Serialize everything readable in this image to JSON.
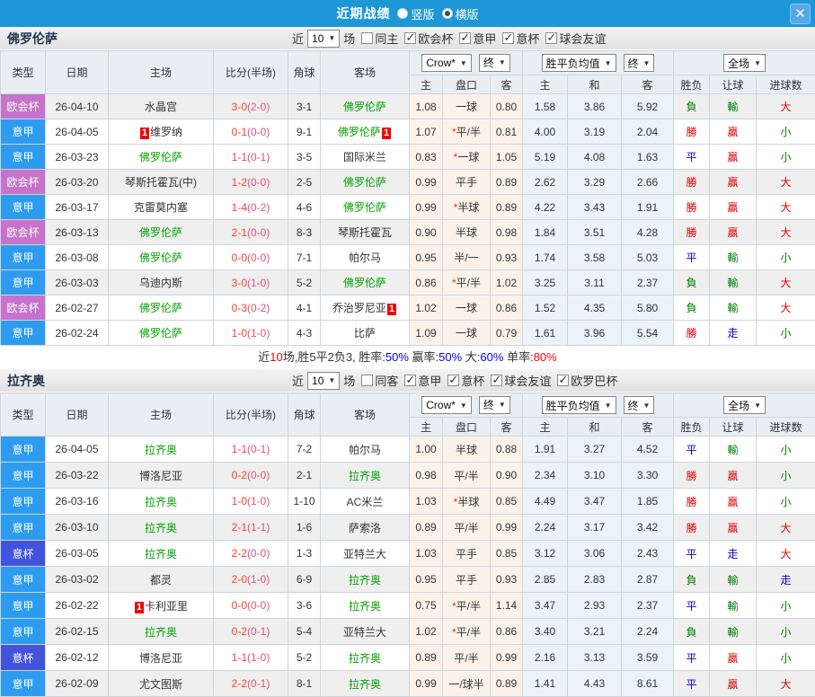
{
  "topbar": {
    "title": "近期战绩",
    "radios": [
      {
        "label": "竖版",
        "selected": false
      },
      {
        "label": "横版",
        "selected": true
      }
    ],
    "close_glyph": "✕"
  },
  "table_header": {
    "cols": [
      "类型",
      "日期",
      "主场",
      "比分(半场)",
      "角球",
      "客场"
    ],
    "dropdowns": {
      "odds": "Crow*",
      "final1": "终",
      "avg": "胜平负均值",
      "final2": "终",
      "full": "全场"
    },
    "arrow": "▼",
    "sub": [
      "主",
      "盘口",
      "客",
      "主",
      "和",
      "客",
      "胜负",
      "让球",
      "进球数"
    ]
  },
  "league_colors": {
    "欧会杯": "#c573cb",
    "意甲": "#2d9cf0",
    "意杯": "#4254de"
  },
  "result_colors": {
    "勝": "#e00000",
    "贏": "#e00000",
    "大": "#e00000",
    "平": "#0000dd",
    "走": "#0000dd",
    "負": "#008000",
    "輸": "#008000",
    "小": "#008000"
  },
  "sections": [
    {
      "team": "佛罗伦萨",
      "filters": {
        "near_label": "近",
        "count": "10",
        "games_label": "场",
        "checkboxes": [
          {
            "label": "同主",
            "checked": false
          },
          {
            "label": "欧会杯",
            "checked": true
          },
          {
            "label": "意甲",
            "checked": true
          },
          {
            "label": "意杯",
            "checked": true
          },
          {
            "label": "球会友谊",
            "checked": true
          }
        ]
      },
      "rows": [
        {
          "league": "欧会杯",
          "date": "26-04-10",
          "home": {
            "name": "水晶宫"
          },
          "score": "3-0(2-0)",
          "corner": "3-1",
          "away": {
            "name": "佛罗伦萨",
            "focus": true
          },
          "odds": [
            "1.08",
            "一球",
            "0.80"
          ],
          "avg": [
            "1.58",
            "3.86",
            "5.92"
          ],
          "res": [
            "負",
            "輸",
            "大"
          ],
          "shaded": true
        },
        {
          "league": "意甲",
          "date": "26-04-05",
          "home": {
            "name": "维罗纳",
            "red": "1",
            "red_pos": "before"
          },
          "score": "0-1(0-0)",
          "corner": "9-1",
          "away": {
            "name": "佛罗伦萨",
            "focus": true,
            "red": "1",
            "red_pos": "after"
          },
          "odds": [
            "1.07",
            "*平/半",
            "0.81"
          ],
          "avg": [
            "4.00",
            "3.19",
            "2.04"
          ],
          "res": [
            "勝",
            "贏",
            "小"
          ],
          "shaded": false
        },
        {
          "league": "意甲",
          "date": "26-03-23",
          "home": {
            "name": "佛罗伦萨",
            "focus": true
          },
          "score": "1-1(0-1)",
          "corner": "3-5",
          "away": {
            "name": "国际米兰"
          },
          "odds": [
            "0.83",
            "*一球",
            "1.05"
          ],
          "avg": [
            "5.19",
            "4.08",
            "1.63"
          ],
          "res": [
            "平",
            "贏",
            "小"
          ],
          "shaded": false
        },
        {
          "league": "欧会杯",
          "date": "26-03-20",
          "home": {
            "name": "琴斯托霍瓦(中)"
          },
          "score": "1-2(0-0)",
          "corner": "2-5",
          "away": {
            "name": "佛罗伦萨",
            "focus": true
          },
          "odds": [
            "0.99",
            "平手",
            "0.89"
          ],
          "avg": [
            "2.62",
            "3.29",
            "2.66"
          ],
          "res": [
            "勝",
            "贏",
            "大"
          ],
          "shaded": true
        },
        {
          "league": "意甲",
          "date": "26-03-17",
          "home": {
            "name": "克雷莫内塞"
          },
          "score": "1-4(0-2)",
          "corner": "4-6",
          "away": {
            "name": "佛罗伦萨",
            "focus": true
          },
          "odds": [
            "0.99",
            "*半球",
            "0.89"
          ],
          "avg": [
            "4.22",
            "3.43",
            "1.91"
          ],
          "res": [
            "勝",
            "贏",
            "大"
          ],
          "shaded": false
        },
        {
          "league": "欧会杯",
          "date": "26-03-13",
          "home": {
            "name": "佛罗伦萨",
            "focus": true
          },
          "score": "2-1(0-0)",
          "corner": "8-3",
          "away": {
            "name": "琴斯托霍瓦"
          },
          "odds": [
            "0.90",
            "半球",
            "0.98"
          ],
          "avg": [
            "1.84",
            "3.51",
            "4.28"
          ],
          "res": [
            "勝",
            "贏",
            "大"
          ],
          "shaded": true
        },
        {
          "league": "意甲",
          "date": "26-03-08",
          "home": {
            "name": "佛罗伦萨",
            "focus": true
          },
          "score": "0-0(0-0)",
          "corner": "7-1",
          "away": {
            "name": "帕尔马"
          },
          "odds": [
            "0.95",
            "半/一",
            "0.93"
          ],
          "avg": [
            "1.74",
            "3.58",
            "5.03"
          ],
          "res": [
            "平",
            "輸",
            "小"
          ],
          "shaded": false
        },
        {
          "league": "意甲",
          "date": "26-03-03",
          "home": {
            "name": "乌迪内斯"
          },
          "score": "3-0(1-0)",
          "corner": "5-2",
          "away": {
            "name": "佛罗伦萨",
            "focus": true
          },
          "odds": [
            "0.86",
            "*平/半",
            "1.02"
          ],
          "avg": [
            "3.25",
            "3.11",
            "2.37"
          ],
          "res": [
            "負",
            "輸",
            "大"
          ],
          "shaded": true
        },
        {
          "league": "欧会杯",
          "date": "26-02-27",
          "home": {
            "name": "佛罗伦萨",
            "focus": true
          },
          "score": "0-3(0-2)",
          "corner": "4-1",
          "away": {
            "name": "乔治罗尼亚",
            "red": "1",
            "red_pos": "after"
          },
          "odds": [
            "1.02",
            "一球",
            "0.86"
          ],
          "avg": [
            "1.52",
            "4.35",
            "5.80"
          ],
          "res": [
            "負",
            "輸",
            "大"
          ],
          "shaded": false
        },
        {
          "league": "意甲",
          "date": "26-02-24",
          "home": {
            "name": "佛罗伦萨",
            "focus": true
          },
          "score": "1-0(1-0)",
          "corner": "4-3",
          "away": {
            "name": "比萨"
          },
          "odds": [
            "1.09",
            "一球",
            "0.79"
          ],
          "avg": [
            "1.61",
            "3.96",
            "5.54"
          ],
          "res": [
            "勝",
            "走",
            "小"
          ],
          "shaded": false
        }
      ],
      "summary": [
        {
          "t": "近",
          "c": "#333333"
        },
        {
          "t": "10",
          "c": "#ff0000"
        },
        {
          "t": "场,胜5平2负3, 胜率:",
          "c": "#333333"
        },
        {
          "t": "50%",
          "c": "#0000ff"
        },
        {
          "t": " 赢率:",
          "c": "#333333"
        },
        {
          "t": "50%",
          "c": "#0000ff"
        },
        {
          "t": " 大:",
          "c": "#333333"
        },
        {
          "t": "60%",
          "c": "#0000ff"
        },
        {
          "t": " 单率:",
          "c": "#333333"
        },
        {
          "t": "80%",
          "c": "#ff0000"
        }
      ]
    },
    {
      "team": "拉齐奥",
      "filters": {
        "near_label": "近",
        "count": "10",
        "games_label": "场",
        "checkboxes": [
          {
            "label": "同客",
            "checked": false
          },
          {
            "label": "意甲",
            "checked": true
          },
          {
            "label": "意杯",
            "checked": true
          },
          {
            "label": "球会友谊",
            "checked": true
          },
          {
            "label": "欧罗巴杯",
            "checked": true
          }
        ]
      },
      "rows": [
        {
          "league": "意甲",
          "date": "26-04-05",
          "home": {
            "name": "拉齐奥",
            "focus": true
          },
          "score": "1-1(0-1)",
          "corner": "7-2",
          "away": {
            "name": "帕尔马"
          },
          "odds": [
            "1.00",
            "半球",
            "0.88"
          ],
          "avg": [
            "1.91",
            "3.27",
            "4.52"
          ],
          "res": [
            "平",
            "輸",
            "小"
          ],
          "shaded": false
        },
        {
          "league": "意甲",
          "date": "26-03-22",
          "home": {
            "name": "博洛尼亚"
          },
          "score": "0-2(0-0)",
          "corner": "2-1",
          "away": {
            "name": "拉齐奥",
            "focus": true
          },
          "odds": [
            "0.98",
            "平/半",
            "0.90"
          ],
          "avg": [
            "2.34",
            "3.10",
            "3.30"
          ],
          "res": [
            "勝",
            "贏",
            "小"
          ],
          "shaded": true
        },
        {
          "league": "意甲",
          "date": "26-03-16",
          "home": {
            "name": "拉齐奥",
            "focus": true
          },
          "score": "1-0(1-0)",
          "corner": "1-10",
          "away": {
            "name": "AC米兰"
          },
          "odds": [
            "1.03",
            "*半球",
            "0.85"
          ],
          "avg": [
            "4.49",
            "3.47",
            "1.85"
          ],
          "res": [
            "勝",
            "贏",
            "小"
          ],
          "shaded": false
        },
        {
          "league": "意甲",
          "date": "26-03-10",
          "home": {
            "name": "拉齐奥",
            "focus": true
          },
          "score": "2-1(1-1)",
          "corner": "1-6",
          "away": {
            "name": "萨索洛"
          },
          "odds": [
            "0.89",
            "平/半",
            "0.99"
          ],
          "avg": [
            "2.24",
            "3.17",
            "3.42"
          ],
          "res": [
            "勝",
            "贏",
            "大"
          ],
          "shaded": true
        },
        {
          "league": "意杯",
          "date": "26-03-05",
          "home": {
            "name": "拉齐奥",
            "focus": true
          },
          "score": "2-2(0-0)",
          "corner": "1-3",
          "away": {
            "name": "亚特兰大"
          },
          "odds": [
            "1.03",
            "平手",
            "0.85"
          ],
          "avg": [
            "3.12",
            "3.06",
            "2.43"
          ],
          "res": [
            "平",
            "走",
            "大"
          ],
          "shaded": false
        },
        {
          "league": "意甲",
          "date": "26-03-02",
          "home": {
            "name": "都灵"
          },
          "score": "2-0(1-0)",
          "corner": "6-9",
          "away": {
            "name": "拉齐奥",
            "focus": true
          },
          "odds": [
            "0.95",
            "平手",
            "0.93"
          ],
          "avg": [
            "2.85",
            "2.83",
            "2.87"
          ],
          "res": [
            "負",
            "輸",
            "走"
          ],
          "shaded": true
        },
        {
          "league": "意甲",
          "date": "26-02-22",
          "home": {
            "name": "卡利亚里",
            "red": "1",
            "red_pos": "before"
          },
          "score": "0-0(0-0)",
          "corner": "3-6",
          "away": {
            "name": "拉齐奥",
            "focus": true
          },
          "odds": [
            "0.75",
            "*平/半",
            "1.14"
          ],
          "avg": [
            "3.47",
            "2.93",
            "2.37"
          ],
          "res": [
            "平",
            "輸",
            "小"
          ],
          "shaded": false
        },
        {
          "league": "意甲",
          "date": "26-02-15",
          "home": {
            "name": "拉齐奥",
            "focus": true
          },
          "score": "0-2(0-1)",
          "corner": "5-4",
          "away": {
            "name": "亚特兰大"
          },
          "odds": [
            "1.02",
            "*平/半",
            "0.86"
          ],
          "avg": [
            "3.40",
            "3.21",
            "2.24"
          ],
          "res": [
            "負",
            "輸",
            "小"
          ],
          "shaded": true
        },
        {
          "league": "意杯",
          "date": "26-02-12",
          "home": {
            "name": "博洛尼亚"
          },
          "score": "1-1(1-0)",
          "corner": "5-2",
          "away": {
            "name": "拉齐奥",
            "focus": true
          },
          "odds": [
            "0.89",
            "平/半",
            "0.99"
          ],
          "avg": [
            "2.16",
            "3.13",
            "3.59"
          ],
          "res": [
            "平",
            "贏",
            "小"
          ],
          "shaded": false
        },
        {
          "league": "意甲",
          "date": "26-02-09",
          "home": {
            "name": "尤文图斯"
          },
          "score": "2-2(0-1)",
          "corner": "8-1",
          "away": {
            "name": "拉齐奥",
            "focus": true
          },
          "odds": [
            "0.99",
            "一/球半",
            "0.89"
          ],
          "avg": [
            "1.41",
            "4.43",
            "8.61"
          ],
          "res": [
            "平",
            "贏",
            "大"
          ],
          "shaded": true
        }
      ],
      "summary": null
    }
  ]
}
